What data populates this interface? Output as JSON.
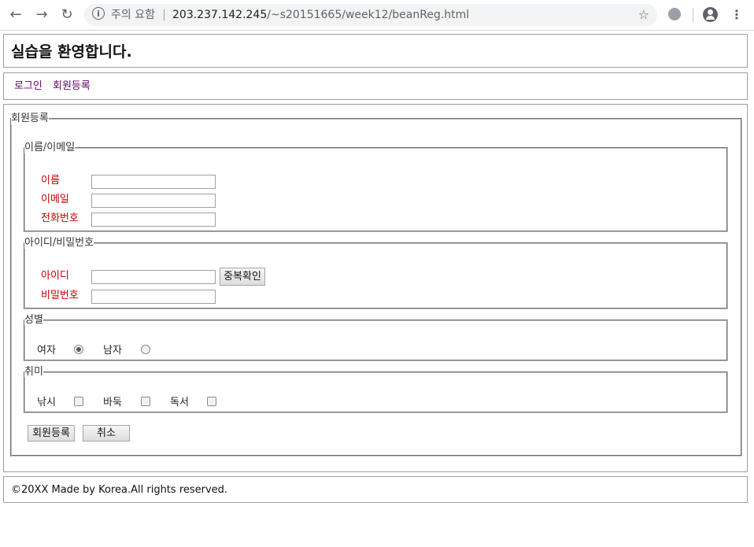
{
  "browser": {
    "security_warning": "주의 요함",
    "url_host": "203.237.142.245",
    "url_path": "/~s20151665/week12/beanReg.html"
  },
  "header": {
    "title": "실습을 환영합니다."
  },
  "nav": {
    "login": "로그인",
    "register": "회원등록"
  },
  "form": {
    "legend": "회원등록",
    "name_email": {
      "legend": "이름/이메일",
      "name_label": "이름",
      "email_label": "이메일",
      "phone_label": "전화번호",
      "name_value": "",
      "email_value": "",
      "phone_value": ""
    },
    "account": {
      "legend": "아이디/비밀번호",
      "id_label": "아이디",
      "password_label": "비밀번호",
      "check_button": "중복확인",
      "id_value": "",
      "password_value": ""
    },
    "gender": {
      "legend": "성별",
      "female": "여자",
      "male": "남자",
      "selected": "여자"
    },
    "hobby": {
      "legend": "취미",
      "fishing": "낚시",
      "baduk": "바둑",
      "reading": "독서"
    },
    "submit_button": "회원등록",
    "cancel_button": "취소"
  },
  "footer": {
    "text": "©20XX Made by Korea.All rights reserved."
  }
}
